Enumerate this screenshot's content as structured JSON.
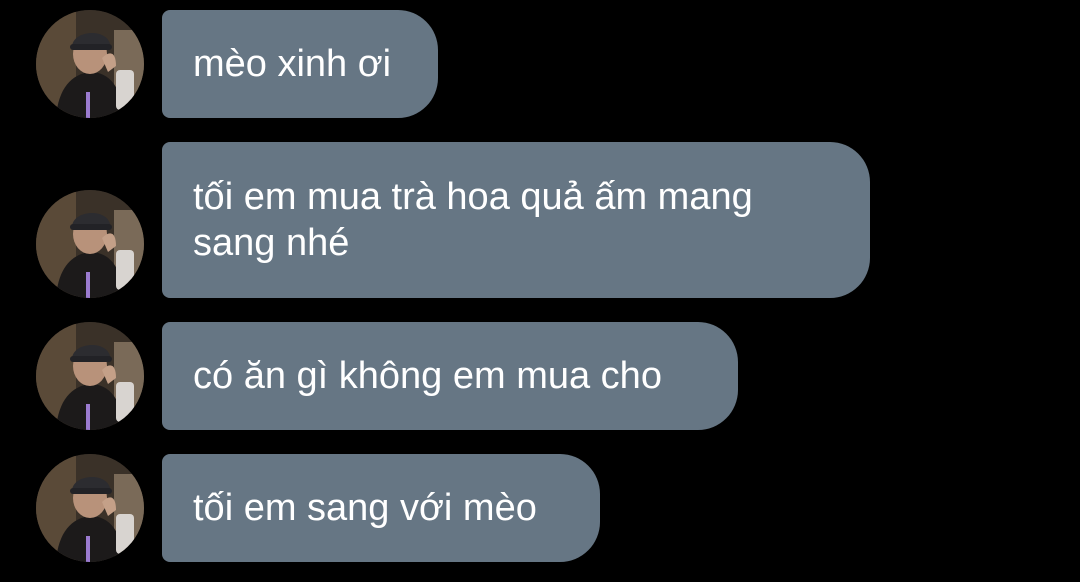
{
  "chat": {
    "messages": [
      {
        "text": "mèo xinh ơi",
        "avatar": "user-photo"
      },
      {
        "text": "tối em mua trà hoa quả ấm mang sang nhé",
        "avatar": "user-photo"
      },
      {
        "text": "có ăn gì không em mua cho",
        "avatar": "user-photo"
      },
      {
        "text": "tối em sang với mèo",
        "avatar": "user-photo"
      }
    ],
    "colors": {
      "background": "#000000",
      "bubble": "#667684",
      "text": "#ffffff"
    }
  }
}
